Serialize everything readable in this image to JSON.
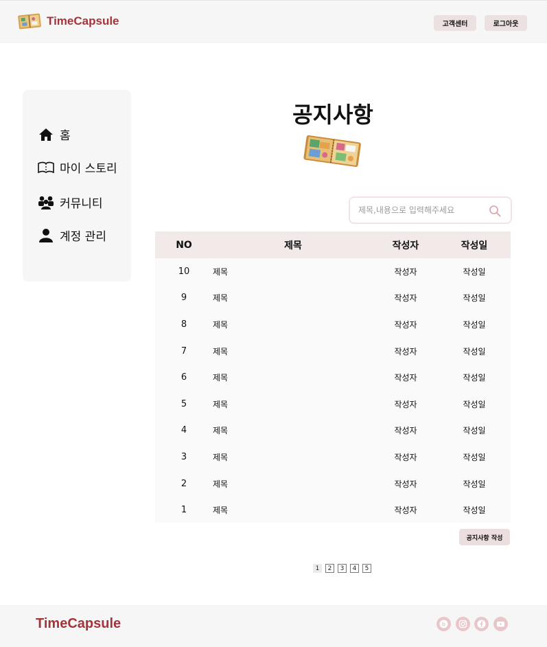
{
  "header": {
    "brand": "TimeCapsule",
    "support_label": "고객센터",
    "logout_label": "로그아웃"
  },
  "sidebar": {
    "items": [
      {
        "label": "홈",
        "icon": "home-icon"
      },
      {
        "label": "마이 스토리",
        "icon": "book-icon"
      },
      {
        "label": "커뮤니티",
        "icon": "people-icon"
      },
      {
        "label": "계정 관리",
        "icon": "user-icon"
      }
    ]
  },
  "main": {
    "title": "공지사항",
    "search_placeholder": "제목,내용으로 입력해주세요",
    "table": {
      "headers": {
        "no": "NO",
        "title": "제목",
        "author": "작성자",
        "date": "작성일"
      },
      "rows": [
        {
          "no": "10",
          "title": "제목",
          "author": "작성자",
          "date": "작성일"
        },
        {
          "no": "9",
          "title": "제목",
          "author": "작성자",
          "date": "작성일"
        },
        {
          "no": "8",
          "title": "제목",
          "author": "작성자",
          "date": "작성일"
        },
        {
          "no": "7",
          "title": "제목",
          "author": "작성자",
          "date": "작성일"
        },
        {
          "no": "6",
          "title": "제목",
          "author": "작성자",
          "date": "작성일"
        },
        {
          "no": "5",
          "title": "제목",
          "author": "작성자",
          "date": "작성일"
        },
        {
          "no": "4",
          "title": "제목",
          "author": "작성자",
          "date": "작성일"
        },
        {
          "no": "3",
          "title": "제목",
          "author": "작성자",
          "date": "작성일"
        },
        {
          "no": "2",
          "title": "제목",
          "author": "작성자",
          "date": "작성일"
        },
        {
          "no": "1",
          "title": "제목",
          "author": "작성자",
          "date": "작성일"
        }
      ]
    },
    "write_button": "공지사항 작성",
    "pages": [
      "1",
      "2",
      "3",
      "4",
      "5"
    ],
    "current_page": "1"
  },
  "footer": {
    "brand": "TimeCapsule",
    "social": [
      "blog-icon",
      "instagram-icon",
      "facebook-icon",
      "youtube-icon"
    ]
  },
  "colors": {
    "brand": "#a3343a",
    "header_bg": "#f7f6f6",
    "table_header_bg": "#f2e9e9",
    "button_bg": "#ebe1e1",
    "social_bg": "#e8c7cb"
  }
}
